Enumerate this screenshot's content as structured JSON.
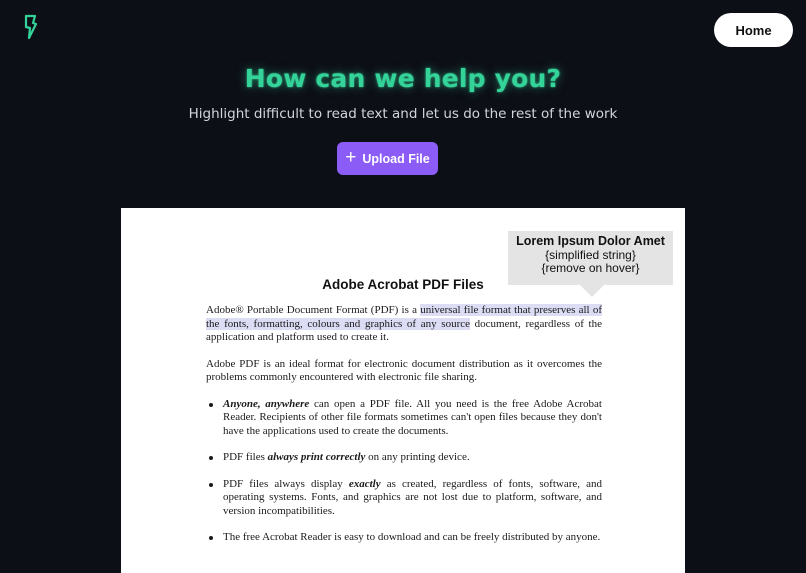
{
  "header": {
    "logo_icon": "bolt-logo-icon",
    "home_label": "Home"
  },
  "hero": {
    "title": "How can we help you?",
    "subtitle": "Highlight difficult to read text and let us do the rest of the work",
    "upload_icon": "plus-icon",
    "upload_label": "Upload File"
  },
  "tooltip": {
    "title": "Lorem Ipsum Dolor Amet",
    "line1": "{simplified string}",
    "line2": "{remove on hover}"
  },
  "document": {
    "title": "Adobe Acrobat PDF Files",
    "p1_before": "Adobe® Portable Document Format (PDF) is a ",
    "p1_highlight": "universal file format that preserves all of the fonts, formatting, colours and graphics of any source",
    "p1_after": " document, regardless of the application and platform used to create it.",
    "p2": "Adobe PDF is an ideal format for electronic document distribution as it overcomes the problems commonly encountered with electronic file sharing.",
    "b1_em": "Anyone, anywhere",
    "b1_rest": " can open a PDF file. All you need is the free Adobe Acrobat Reader. Recipients of other file formats sometimes can't open files because they don't have the applications used to create the documents.",
    "b2_before": "PDF files ",
    "b2_em": "always print correctly",
    "b2_after": " on any printing device.",
    "b3_before": "PDF files always display ",
    "b3_em": "exactly",
    "b3_after": " as created, regardless of fonts, software, and operating systems. Fonts, and graphics are not lost due to platform, software, and version incompatibilities.",
    "b4": "The free Acrobat Reader is easy to download and can be freely distributed by anyone."
  },
  "colors": {
    "background": "#0d0f17",
    "accent_green": "#34d399",
    "upload_purple": "#8b5cf6",
    "highlight": "#dcdcf5"
  }
}
